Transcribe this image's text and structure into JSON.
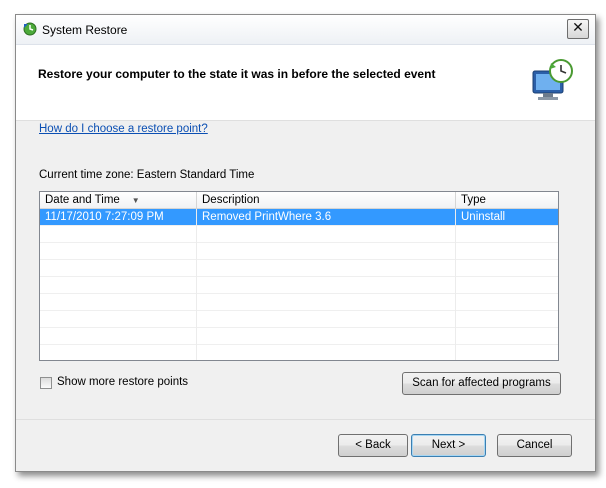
{
  "window": {
    "title": "System Restore",
    "close_label": "✕"
  },
  "header": {
    "text": "Restore your computer to the state it was in before the selected event"
  },
  "help_link": "How do I choose a restore point?",
  "timezone_text": "Current time zone: Eastern Standard Time",
  "table": {
    "columns": [
      "Date and Time",
      "Description",
      "Type"
    ],
    "sort_indicator": "▼",
    "rows": [
      {
        "date": "11/17/2010 7:27:09 PM",
        "description": "Removed PrintWhere 3.6",
        "type": "Uninstall",
        "selected": true
      }
    ]
  },
  "show_more": {
    "label": "Show more restore points",
    "checked": false
  },
  "buttons": {
    "scan": "Scan for affected programs",
    "back": "< Back",
    "next": "Next >",
    "cancel": "Cancel"
  },
  "icons": {
    "title_icon": "system-restore-icon",
    "header_icon": "computer-restore-icon"
  },
  "colors": {
    "selection": "#3399ff",
    "link": "#0b4fb3"
  }
}
